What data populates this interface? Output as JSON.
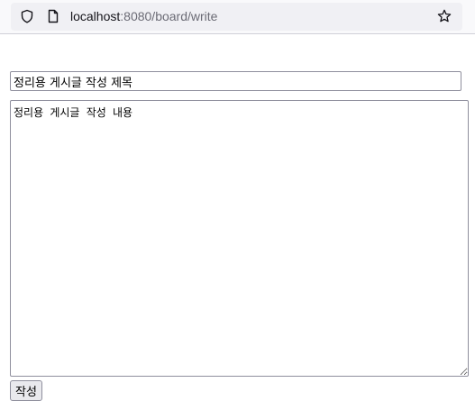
{
  "browser": {
    "url_host": "localhost",
    "url_rest": ":8080/board/write",
    "icons": {
      "security": "shield-icon",
      "page": "page-icon",
      "bookmark": "star-icon"
    }
  },
  "form": {
    "title_value": "정리용 게시글 작성 제목",
    "content_value": "정리용 게시글 작성 내용",
    "submit_label": "작성"
  }
}
